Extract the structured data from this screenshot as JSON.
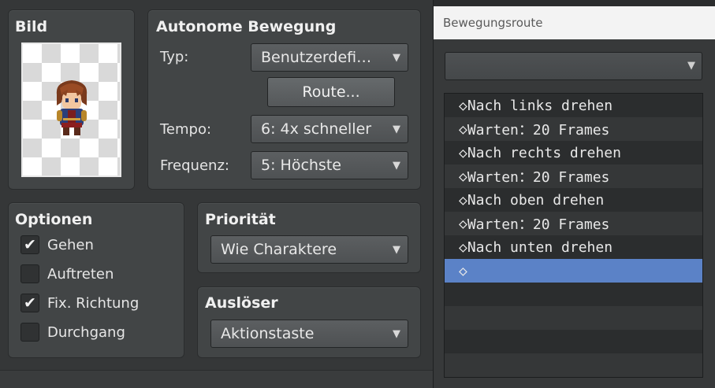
{
  "image_panel": {
    "title": "Bild"
  },
  "autonomous": {
    "title": "Autonome Bewegung",
    "type_label": "Typ:",
    "type_value": "Benutzerdefi…",
    "route_button": "Route...",
    "speed_label": "Tempo:",
    "speed_value": "6: 4x schneller",
    "frequency_label": "Frequenz:",
    "frequency_value": "5: Höchste"
  },
  "options": {
    "title": "Optionen",
    "items": [
      {
        "label": "Gehen",
        "checked": true,
        "mark": "✔"
      },
      {
        "label": "Auftreten",
        "checked": false,
        "mark": ""
      },
      {
        "label": "Fix. Richtung",
        "checked": true,
        "mark": "✔"
      },
      {
        "label": "Durchgang",
        "checked": false,
        "mark": ""
      }
    ]
  },
  "priority": {
    "title": "Priorität",
    "value": "Wie Charaktere"
  },
  "trigger": {
    "title": "Auslöser",
    "value": "Aktionstaste"
  },
  "route_window": {
    "title": "Bewegungsroute",
    "combo_value": "",
    "diamond": "◇",
    "commands": [
      "Nach links drehen",
      "Warten：20 Frames",
      "Nach rechts drehen",
      "Warten：20 Frames",
      "Nach oben drehen",
      "Warten：20 Frames",
      "Nach unten drehen",
      ""
    ],
    "selected_index": 7
  },
  "icons": {
    "dropdown": "▼",
    "checkmark": "✔",
    "route_command": "◇"
  },
  "colors": {
    "selection": "#5b82c7",
    "panel": "#424546",
    "background": "#353738"
  }
}
